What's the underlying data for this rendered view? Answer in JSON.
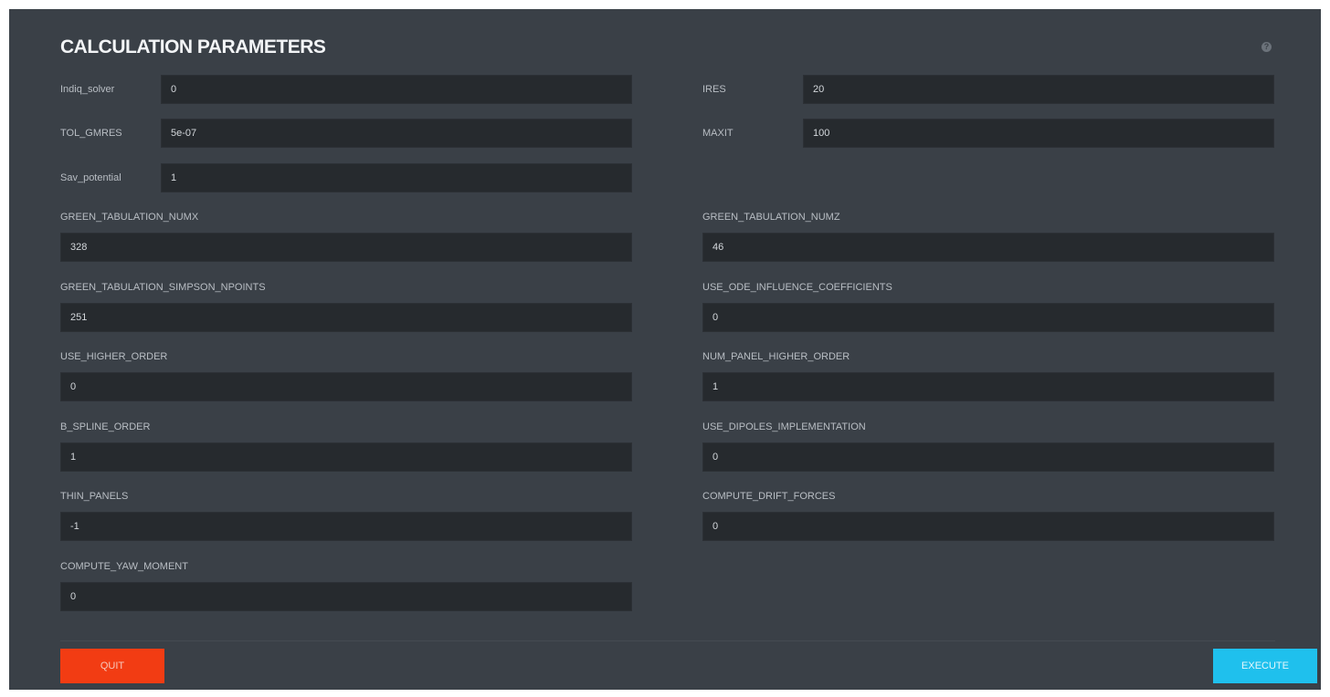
{
  "header": {
    "title": "CALCULATION PARAMETERS",
    "help_icon": "?"
  },
  "inline_fields": {
    "left": [
      {
        "label": "Indiq_solver",
        "value": "0"
      },
      {
        "label": "TOL_GMRES",
        "value": "5e-07"
      },
      {
        "label": "Sav_potential",
        "value": "1"
      }
    ],
    "right": [
      {
        "label": "IRES",
        "value": "20"
      },
      {
        "label": "MAXIT",
        "value": "100"
      }
    ]
  },
  "stacked_fields": {
    "left": [
      {
        "label": "GREEN_TABULATION_NUMX",
        "value": "328"
      },
      {
        "label": "GREEN_TABULATION_SIMPSON_NPOINTS",
        "value": "251"
      },
      {
        "label": "USE_HIGHER_ORDER",
        "value": "0"
      },
      {
        "label": "B_SPLINE_ORDER",
        "value": "1"
      },
      {
        "label": "THIN_PANELS",
        "value": "-1"
      },
      {
        "label": "COMPUTE_YAW_MOMENT",
        "value": "0"
      }
    ],
    "right": [
      {
        "label": "GREEN_TABULATION_NUMZ",
        "value": "46"
      },
      {
        "label": "USE_ODE_INFLUENCE_COEFFICIENTS",
        "value": "0"
      },
      {
        "label": "NUM_PANEL_HIGHER_ORDER",
        "value": "1"
      },
      {
        "label": "USE_DIPOLES_IMPLEMENTATION",
        "value": "0"
      },
      {
        "label": "COMPUTE_DRIFT_FORCES",
        "value": "0"
      }
    ]
  },
  "footer": {
    "quit_label": "QUIT",
    "execute_label": "EXECUTE"
  },
  "colors": {
    "panel_bg": "#3a4047",
    "input_bg": "#262a2e",
    "quit": "#f23c13",
    "execute": "#1fc0ed"
  }
}
